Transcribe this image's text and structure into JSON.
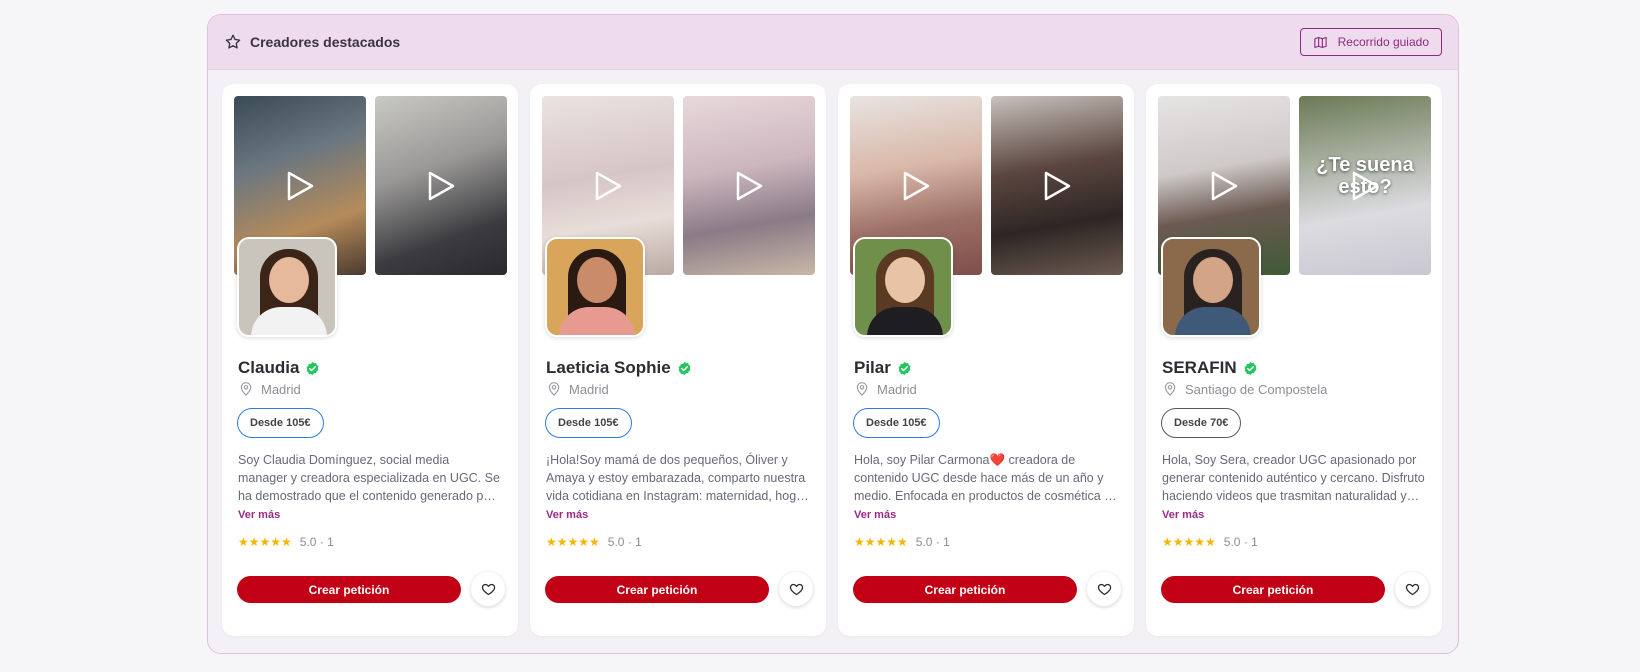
{
  "panel": {
    "title": "Creadores destacados",
    "title_icon": "star-outline-icon",
    "tour_button": "Recorrido guiado",
    "tour_icon": "map-icon"
  },
  "colors": {
    "accent": "#8e2a7e",
    "cta": "#c10016",
    "verified": "#22c55e",
    "stars": "#f4b400",
    "header_bg": "#efdbee"
  },
  "creators": [
    {
      "name": "Claudia",
      "location": "Madrid",
      "price": "Desde 105€",
      "description": "Soy Claudia Domínguez, social media manager y creadora especializada en UGC. Se ha demostrado que el contenido generado por usuarios genera más confianza...",
      "more": "Ver más",
      "rating_text": "5.0 · 1",
      "stars": 5,
      "cta": "Crear petición",
      "thumbs": [
        {
          "bg": "linear-gradient(160deg,#3a4a55 0%,#6a7680 35%,#b58b5a 70%,#4a3a30 100%)",
          "text": ""
        },
        {
          "bg": "linear-gradient(160deg,#c9c9c4 0%,#9a9896 40%,#3c3c40 75%,#2a2a2e 100%)",
          "text": ""
        }
      ],
      "avatar": {
        "bg": "#c9c4bc",
        "hair": "#3b2418",
        "skin": "#e6b89c",
        "body": "#f2f2f2"
      }
    },
    {
      "name": "Laeticia Sophie",
      "location": "Madrid",
      "price": "Desde 105€",
      "description": "¡Hola!Soy mamá de dos pequeños, Óliver y Amaya y estoy embarazada, comparto nuestra vida cotidiana en Instagram: maternidad, hogar y estilo de vida...",
      "more": "Ver más",
      "rating_text": "5.0 · 1",
      "stars": 5,
      "cta": "Crear petición",
      "thumbs": [
        {
          "bg": "linear-gradient(170deg,#ebe3e0 0%,#d6c6c6 45%,#e8ddd8 70%,#b9aaa2 100%)",
          "text": ""
        },
        {
          "bg": "linear-gradient(170deg,#e8d8dc 0%,#cdb7bf 40%,#8a7b86 70%,#c8b7a8 100%)",
          "text": ""
        }
      ],
      "avatar": {
        "bg": "#d9a55a",
        "hair": "#2a1a12",
        "skin": "#c98b6a",
        "body": "#e79a90"
      }
    },
    {
      "name": "Pilar",
      "location": "Madrid",
      "price": "Desde 105€",
      "description": "Hola, soy Pilar Carmona❤️ creadora de contenido UGC desde hace más de un año y medio. Enfocada en productos de cosmética y belleza...",
      "more": "Ver más",
      "rating_text": "5.0 · 1",
      "stars": 5,
      "cta": "Crear petición",
      "thumbs": [
        {
          "bg": "linear-gradient(170deg,#e8e4e2 0%,#d9b8a8 40%,#9c6f66 70%,#7e4f4a 100%)",
          "text": ""
        },
        {
          "bg": "linear-gradient(170deg,#c9c2bd 0%,#5b4640 40%,#2e2624 70%,#6b5a50 100%)",
          "text": ""
        }
      ],
      "avatar": {
        "bg": "#6f8f4a",
        "hair": "#5a3a22",
        "skin": "#e9c3a6",
        "body": "#1e1e22"
      }
    },
    {
      "name": "SERAFIN",
      "location": "Santiago de Compostela",
      "price": "Desde 70€",
      "description": "Hola, Soy Sera, creador UGC apasionado por generar contenido auténtico y cercano. Disfruto haciendo videos que trasmitan naturalidad y conecten...",
      "more": "Ver más",
      "rating_text": "5.0 · 1",
      "stars": 5,
      "cta": "Crear petición",
      "thumbs": [
        {
          "bg": "linear-gradient(170deg,#e6e4e4 0%,#cfcac8 40%,#6b5a52 65%,#3f5a36 100%)",
          "text": ""
        },
        {
          "bg": "linear-gradient(170deg,#6b7a55 0%,#a8b0a0 35%,#dcdbe0 65%,#c9c8d2 100%)",
          "text": "¿Te suena esto?"
        }
      ],
      "avatar": {
        "bg": "#8a6a4a",
        "hair": "#2a2220",
        "skin": "#d4a486",
        "body": "#3e5a78"
      }
    }
  ]
}
